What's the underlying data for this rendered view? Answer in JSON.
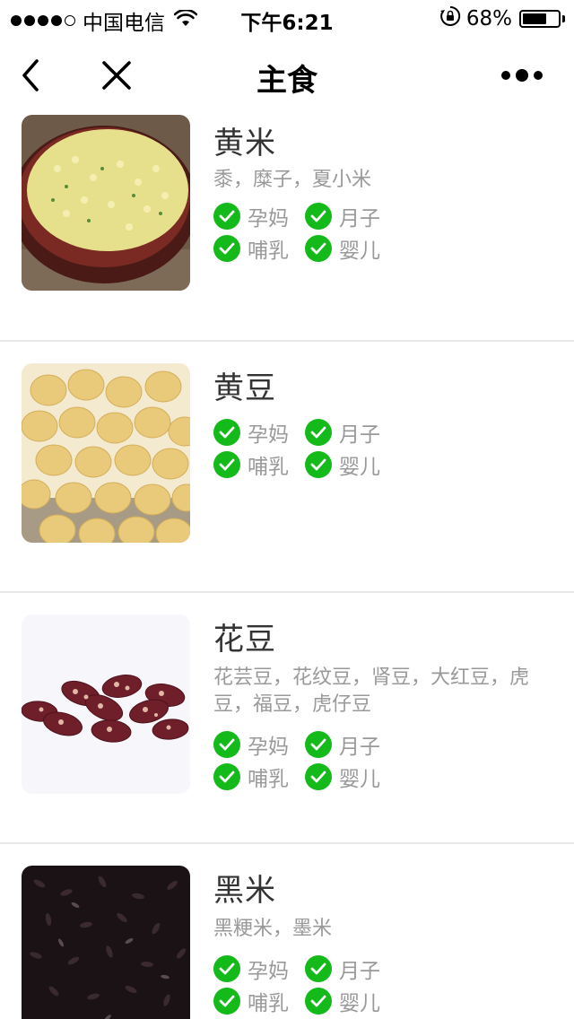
{
  "status_bar": {
    "carrier": "中国电信",
    "time": "下午6:21",
    "battery_percent": "68%",
    "battery_level": 0.68,
    "signal_icon": "signal-dots-icon",
    "wifi_icon": "wifi-icon",
    "rotation_lock_icon": "rotation-lock-icon"
  },
  "nav": {
    "title": "主食",
    "back_icon": "back-chevron-icon",
    "close_icon": "close-icon",
    "more_icon": "more-dots-icon"
  },
  "items": [
    {
      "title": "黄米",
      "alias": "黍，糜子，夏小米",
      "image_icon": "yellow-millet-photo",
      "tags": [
        "孕妈",
        "月子",
        "哺乳",
        "婴儿"
      ]
    },
    {
      "title": "黄豆",
      "alias": "",
      "image_icon": "soybean-photo",
      "tags": [
        "孕妈",
        "月子",
        "哺乳",
        "婴儿"
      ]
    },
    {
      "title": "花豆",
      "alias": "花芸豆，花纹豆，肾豆，大红豆，虎豆，福豆，虎仔豆",
      "image_icon": "speckled-bean-photo",
      "tags": [
        "孕妈",
        "月子",
        "哺乳",
        "婴儿"
      ]
    },
    {
      "title": "黑米",
      "alias": "黑粳米，墨米",
      "image_icon": "black-rice-photo",
      "tags": [
        "孕妈",
        "月子",
        "哺乳",
        "婴儿"
      ]
    }
  ],
  "colors": {
    "check_green": "#14b91a",
    "title_text": "#333333",
    "secondary_text": "#999999",
    "divider": "#e8e8e8"
  }
}
